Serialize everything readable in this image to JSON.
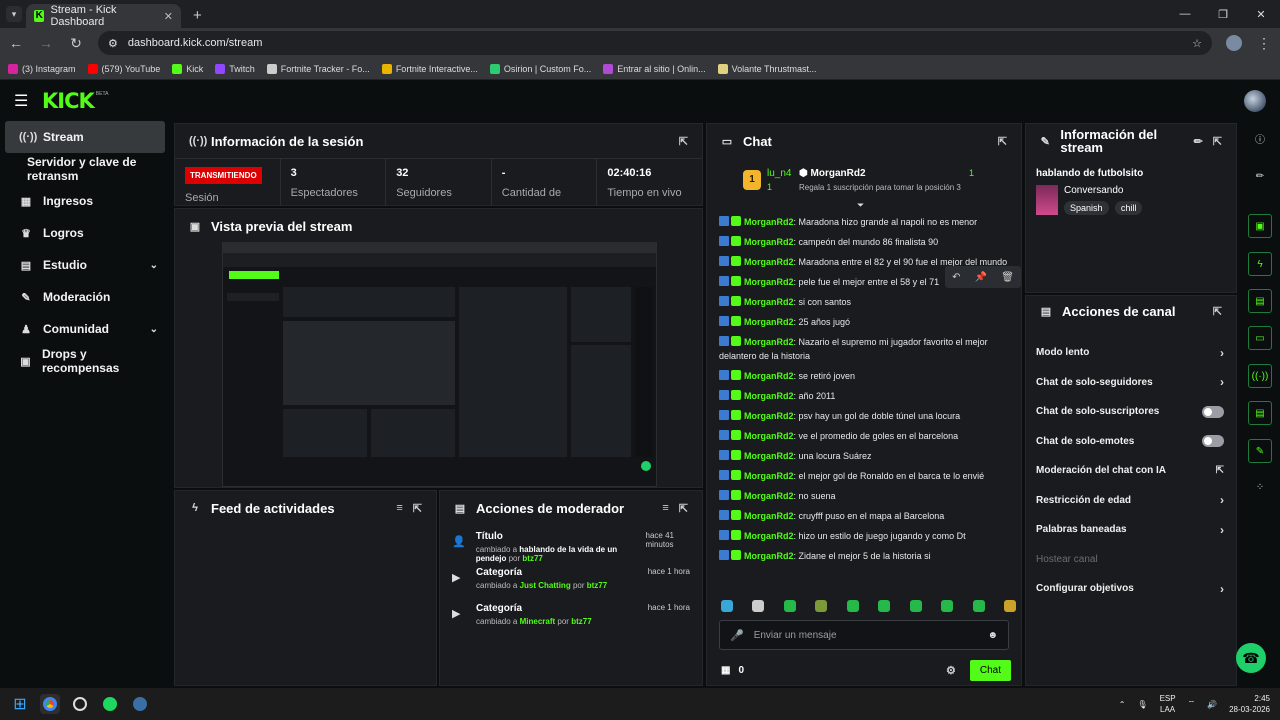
{
  "browser": {
    "tab_title": "Stream - Kick Dashboard",
    "url": "dashboard.kick.com/stream",
    "bookmarks": [
      {
        "label": "(3) Instagram",
        "color": "#d6249f"
      },
      {
        "label": "(579) YouTube",
        "color": "#ff0000"
      },
      {
        "label": "Kick",
        "color": "#53fc18"
      },
      {
        "label": "Twitch",
        "color": "#9146ff"
      },
      {
        "label": "Fortnite Tracker - Fo...",
        "color": "#cccccc"
      },
      {
        "label": "Fortnite Interactive...",
        "color": "#e8b400"
      },
      {
        "label": "Osirion | Custom Fo...",
        "color": "#2ecc71"
      },
      {
        "label": "Entrar al sitio | Onlin...",
        "color": "#b04bd6"
      },
      {
        "label": "Volante Thrustmast...",
        "color": "#e0d080"
      }
    ]
  },
  "app": {
    "logo": "KICK",
    "beta": "BETA"
  },
  "sidebar": {
    "items": [
      {
        "label": "Stream",
        "icon": "broadcast-icon"
      },
      {
        "label": "Servidor y clave de retransm",
        "icon": ""
      },
      {
        "label": "Ingresos",
        "icon": "chart-icon"
      },
      {
        "label": "Logros",
        "icon": "trophy-icon"
      },
      {
        "label": "Estudio",
        "icon": "studio-icon"
      },
      {
        "label": "Moderación",
        "icon": "wrench-icon"
      },
      {
        "label": "Comunidad",
        "icon": "community-icon"
      },
      {
        "label": "Drops y recompensas",
        "icon": "gift-icon"
      }
    ]
  },
  "session": {
    "title": "Información de la sesión",
    "live_badge": "TRANSMITIENDO",
    "status_label": "Sesión",
    "stats": [
      {
        "value": "3",
        "label": "Espectadores"
      },
      {
        "value": "32",
        "label": "Seguidores"
      },
      {
        "value": "-",
        "label": "Cantidad de"
      },
      {
        "value": "02:40:16",
        "label": "Tiempo en vivo"
      }
    ]
  },
  "preview": {
    "title": "Vista previa del stream"
  },
  "feed": {
    "title": "Feed de actividades"
  },
  "mod_actions": {
    "title": "Acciones de moderador",
    "items": [
      {
        "title": "Título",
        "prefix": "cambiado a",
        "value": "hablando de la vida de un pendejo",
        "by": "por",
        "user": "btz77",
        "time": "hace 41 minutos"
      },
      {
        "title": "Categoría",
        "prefix": "cambiado a",
        "value": "Just Chatting",
        "by": "por",
        "user": "btz77",
        "time": "hace 1 hora"
      },
      {
        "title": "Categoría",
        "prefix": "cambiado a",
        "value": "Minecraft",
        "by": "por",
        "user": "btz77",
        "time": "hace 1 hora"
      }
    ]
  },
  "chat": {
    "title": "Chat",
    "pinned": {
      "user1": "lu_n4",
      "count1": "1",
      "user2": "MorganRd2",
      "count2": "1",
      "rank": "1",
      "sub_text": "Regala 1 suscripción para tomar la posición 3"
    },
    "messages": [
      {
        "user": "MorganRd2",
        "text": "Maradona hizo grande al napoli no es menor"
      },
      {
        "user": "MorganRd2",
        "text": "campeón del mundo 86 finalista 90"
      },
      {
        "user": "MorganRd2",
        "text": "Maradona entre el 82 y el 90 fue el mejor del mundo"
      },
      {
        "user": "MorganRd2",
        "text": "pele fue el mejor entre el 58 y el 71"
      },
      {
        "user": "MorganRd2",
        "text": "si con santos"
      },
      {
        "user": "MorganRd2",
        "text": "25 años jugó"
      },
      {
        "user": "MorganRd2",
        "text": "Nazario el supremo mi jugador favorito el mejor delantero de la historia"
      },
      {
        "user": "MorganRd2",
        "text": "se retiró joven"
      },
      {
        "user": "MorganRd2",
        "text": "año 2011"
      },
      {
        "user": "MorganRd2",
        "text": "psv hay un gol de doble túnel una locura"
      },
      {
        "user": "MorganRd2",
        "text": "ve el promedio de goles en el barcelona"
      },
      {
        "user": "MorganRd2",
        "text": "una locura Suárez"
      },
      {
        "user": "MorganRd2",
        "text": "el mejor gol de Ronaldo en el barca te lo envié"
      },
      {
        "user": "MorganRd2",
        "text": "no suena"
      },
      {
        "user": "MorganRd2",
        "text": "cruyfff puso en el mapa al Barcelona"
      },
      {
        "user": "MorganRd2",
        "text": "hizo un estilo de juego jugando y como Dt"
      },
      {
        "user": "MorganRd2",
        "text": "Zidane el mejor 5 de la historia si"
      }
    ],
    "input_placeholder": "Enviar un mensaje",
    "points": "0",
    "send_label": "Chat"
  },
  "stream_info": {
    "title": "Información del stream",
    "stream_title": "hablando de futbolsito",
    "category": "Conversando",
    "tags": [
      "Spanish",
      "chill"
    ]
  },
  "channel_actions": {
    "title": "Acciones de canal",
    "items": [
      {
        "label": "Modo lento",
        "type": "chevron"
      },
      {
        "label": "Chat de solo-seguidores",
        "type": "chevron"
      },
      {
        "label": "Chat de solo-suscriptores",
        "type": "toggle"
      },
      {
        "label": "Chat de solo-emotes",
        "type": "toggle"
      },
      {
        "label": "Moderación del chat con IA",
        "type": "external"
      },
      {
        "label": "Restricción de edad",
        "type": "chevron"
      },
      {
        "label": "Palabras baneadas",
        "type": "chevron"
      },
      {
        "label": "Hostear canal",
        "type": "disabled"
      },
      {
        "label": "Configurar objetivos",
        "type": "chevron"
      }
    ]
  },
  "taskbar": {
    "lang1": "ESP",
    "lang2": "LAA",
    "time": "2:45",
    "date": "28-03-2026"
  }
}
